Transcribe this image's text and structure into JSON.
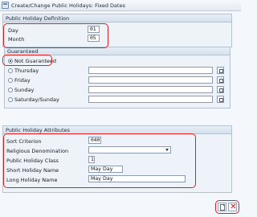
{
  "window": {
    "title": "Create/Change Public Holidays: Fixed Dates"
  },
  "public_holiday_definition": {
    "heading": "Public Holiday Definition",
    "day_label": "Day",
    "day_value": "01",
    "month_label": "Month",
    "month_value": "05"
  },
  "guaranteed": {
    "heading": "Guaranteed",
    "selected": "Not Guaranteed",
    "options": [
      {
        "label": "Not Guaranteed",
        "checked": true
      },
      {
        "label": "Thursday",
        "checked": false
      },
      {
        "label": "Friday",
        "checked": false
      },
      {
        "label": "Sunday",
        "checked": false
      },
      {
        "label": "Saturday/Sunday",
        "checked": false
      }
    ]
  },
  "public_holiday_attributes": {
    "heading": "Public Holiday Attributes",
    "sort_criterion_label": "Sort Criterion",
    "sort_criterion_value": "040",
    "religious_denomination_label": "Religious Denomination",
    "religious_denomination_value": "",
    "public_holiday_class_label": "Public Holiday Class",
    "public_holiday_class_value": "1",
    "short_holiday_name_label": "Short Holiday Name",
    "short_holiday_name_value": "May Day",
    "long_holiday_name_label": "Long Holiday Name",
    "long_holiday_name_value": "May Day"
  },
  "actions": {
    "create_icon": "document-icon",
    "cancel_icon": "close-icon",
    "cancel_symbol": "✕"
  },
  "colors": {
    "highlight": "#e02020",
    "group_border": "#b5c2d2",
    "background": "#eef3f9"
  }
}
